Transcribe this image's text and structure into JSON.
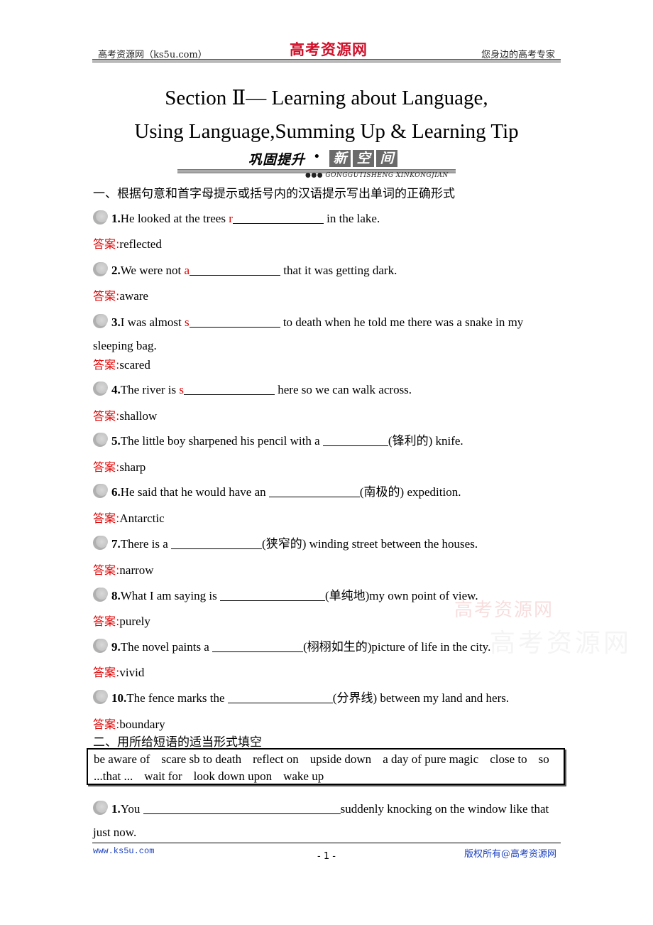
{
  "header": {
    "left": "高考资源网（ks5u.com）",
    "logo": "高考资源网",
    "right": "您身边的高考专家"
  },
  "title": {
    "line1": "Section   Ⅱ— Learning about Language,",
    "line2": "Using Language,Summing Up & Learning Tip"
  },
  "banner": {
    "zh": "巩固提升",
    "dot": "•",
    "boxes": [
      "新",
      "空",
      "间"
    ],
    "sub": "●●● GONGGUTISHENG XINKONGJIAN"
  },
  "section1": {
    "heading": "一、根据句意和首字母提示或括号内的汉语提示写出单词的正确形式",
    "answer_label": "答案:",
    "questions": [
      {
        "num": "1.",
        "before": "He looked at the trees ",
        "hint": "r",
        "after": " in the lake.",
        "answer": "reflected"
      },
      {
        "num": "2.",
        "before": "We were not ",
        "hint": "a",
        "after": " that it was getting dark.",
        "answer": "aware"
      },
      {
        "num": "3.",
        "before": "I was almost ",
        "hint": "s",
        "after": " to death when he told me there was a snake in my sleeping bag.",
        "answer": "scared"
      },
      {
        "num": "4.",
        "before": "The river is ",
        "hint": "s",
        "after": " here so we can walk across.",
        "answer": "shallow"
      },
      {
        "num": "5.",
        "before": "The little boy sharpened his pencil with a ",
        "hint": "",
        "after": "(锋利的) knife.",
        "answer": "sharp"
      },
      {
        "num": "6.",
        "before": "He said that he would have an ",
        "hint": "",
        "after": "(南极的) expedition.",
        "answer": "Antarctic"
      },
      {
        "num": "7.",
        "before": "There is a ",
        "hint": "",
        "after": "(狭窄的) winding street between the houses.",
        "answer": "narrow"
      },
      {
        "num": "8.",
        "before": "What I am saying is ",
        "hint": "",
        "after": "(单纯地)my own point of view.",
        "answer": "purely"
      },
      {
        "num": "9.",
        "before": "The novel paints a ",
        "hint": "",
        "after": "(栩栩如生的)picture of life in the city.",
        "answer": "vivid"
      },
      {
        "num": "10.",
        "before": "The fence marks the ",
        "hint": "",
        "after": "(分界线) between my land and hers.",
        "answer": "boundary"
      }
    ]
  },
  "section2": {
    "heading": "二、用所给短语的适当形式填空",
    "phrases": [
      "be aware of",
      "scare sb to death",
      "reflect on",
      "upside down",
      "a day of pure magic",
      "close to",
      "so ...that ...",
      "wait for",
      "look down upon",
      "wake up"
    ],
    "questions": [
      {
        "num": "1.",
        "before": "You ",
        "after": "suddenly knocking on the window like that just now."
      }
    ]
  },
  "watermark": {
    "line1": "高考资源网",
    "line2": "高考资源网"
  },
  "footer": {
    "left": "www.ks5u.com",
    "page": "- 1 -",
    "right": "版权所有@高考资源网"
  }
}
